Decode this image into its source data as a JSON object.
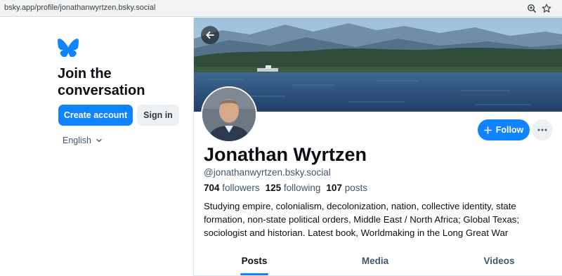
{
  "browser": {
    "url": "bsky.app/profile/jonathanwyrtzen.bsky.social",
    "icons": [
      "zoom-icon",
      "star-icon"
    ]
  },
  "sidebar": {
    "join_line1": "Join the",
    "join_line2": "conversation",
    "create_account_label": "Create account",
    "sign_in_label": "Sign in",
    "language": "English",
    "logo_icon": "butterfly-logo-icon"
  },
  "profile": {
    "display_name": "Jonathan Wyrtzen",
    "handle": "@jonathanwyrtzen.bsky.social",
    "followers_count": "704",
    "followers_label": "followers",
    "following_count": "125",
    "following_label": "following",
    "posts_count": "107",
    "posts_label": "posts",
    "bio": "Studying empire, colonialism, decolonization, nation, collective identity, state formation, non-state political orders, Middle East / North Africa; Global Texas; sociologist and historian. Latest book, Worldmaking in the Long Great War",
    "follow_label": "Follow"
  },
  "tabs": [
    {
      "label": "Posts",
      "active": true
    },
    {
      "label": "Media",
      "active": false
    },
    {
      "label": "Videos",
      "active": false
    }
  ],
  "colors": {
    "accent": "#1083fe",
    "text_primary": "#0b0f14",
    "text_secondary": "#42576c",
    "button_secondary_bg": "#eef1f4"
  }
}
